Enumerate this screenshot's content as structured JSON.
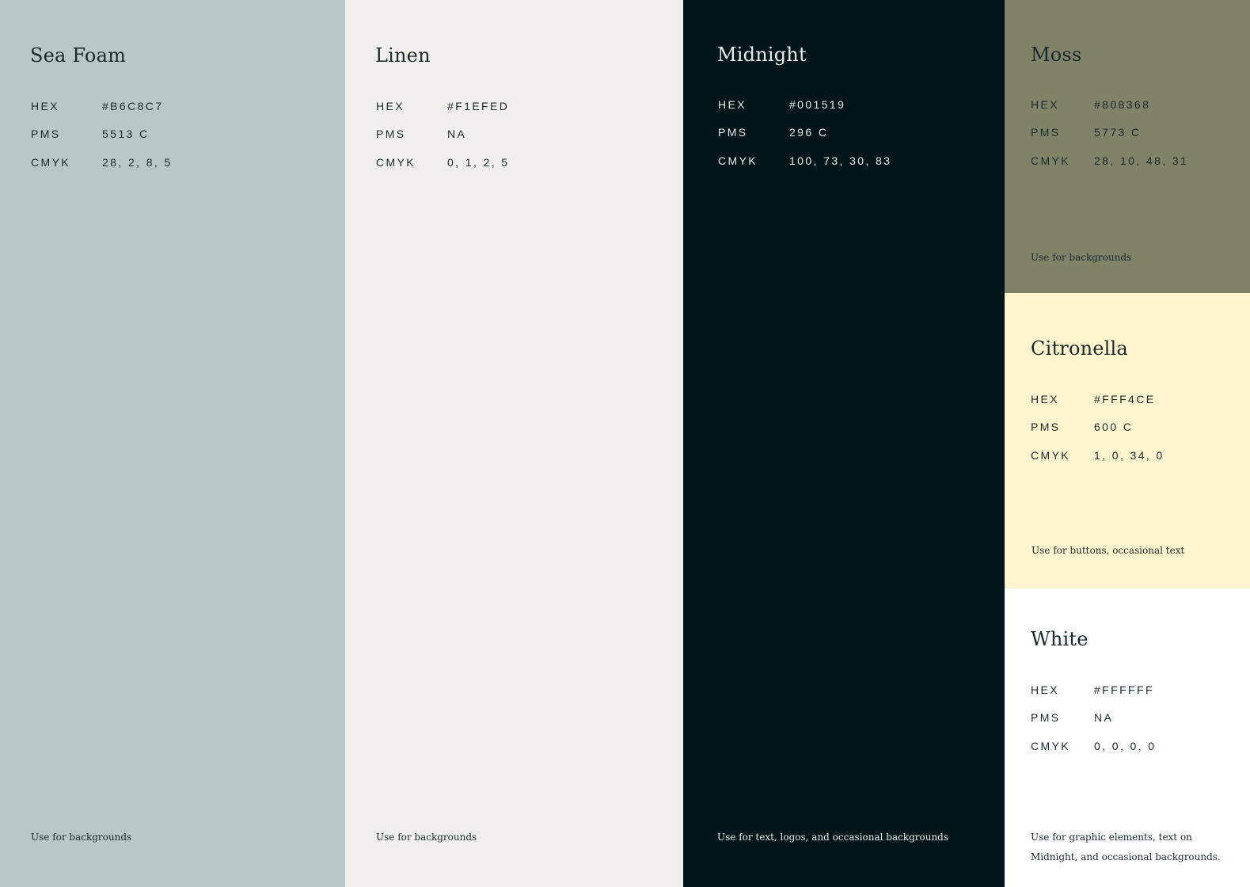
{
  "labels": {
    "hex": "HEX",
    "pms": "PMS",
    "cmyk": "CMYK"
  },
  "swatches": {
    "seafoam": {
      "name": "Sea Foam",
      "color": "#B6C8C7",
      "hex": "#B6C8C7",
      "pms": "5513 C",
      "cmyk": "28, 2, 8, 5",
      "usage": "Use for backgrounds"
    },
    "linen": {
      "name": "Linen",
      "color": "#F1EFED",
      "hex": "#F1EFED",
      "pms": "NA",
      "cmyk": "0, 1, 2, 5",
      "usage": "Use for backgrounds"
    },
    "midnight": {
      "name": "Midnight",
      "color": "#001519",
      "hex": "#001519",
      "pms": "296 C",
      "cmyk": "100, 73, 30, 83",
      "usage": "Use for text, logos, and occasional backgrounds"
    },
    "moss": {
      "name": "Moss",
      "color": "#808368",
      "hex": "#808368",
      "pms": "5773 C",
      "cmyk": "28, 10, 48, 31",
      "usage": "Use for backgrounds"
    },
    "citronella": {
      "name": "Citronella",
      "color": "#FFF4CE",
      "hex": "#FFF4CE",
      "pms": "600 C",
      "cmyk": "1, 0, 34, 0",
      "usage": "Use for buttons, occasional text"
    },
    "white": {
      "name": "White",
      "color": "#FFFFFF",
      "hex": "#FFFFFF",
      "pms": "NA",
      "cmyk": "0, 0, 0, 0",
      "usage_lines": [
        "Use for graphic elements, text on",
        "Midnight, and occasional backgrounds."
      ]
    }
  }
}
